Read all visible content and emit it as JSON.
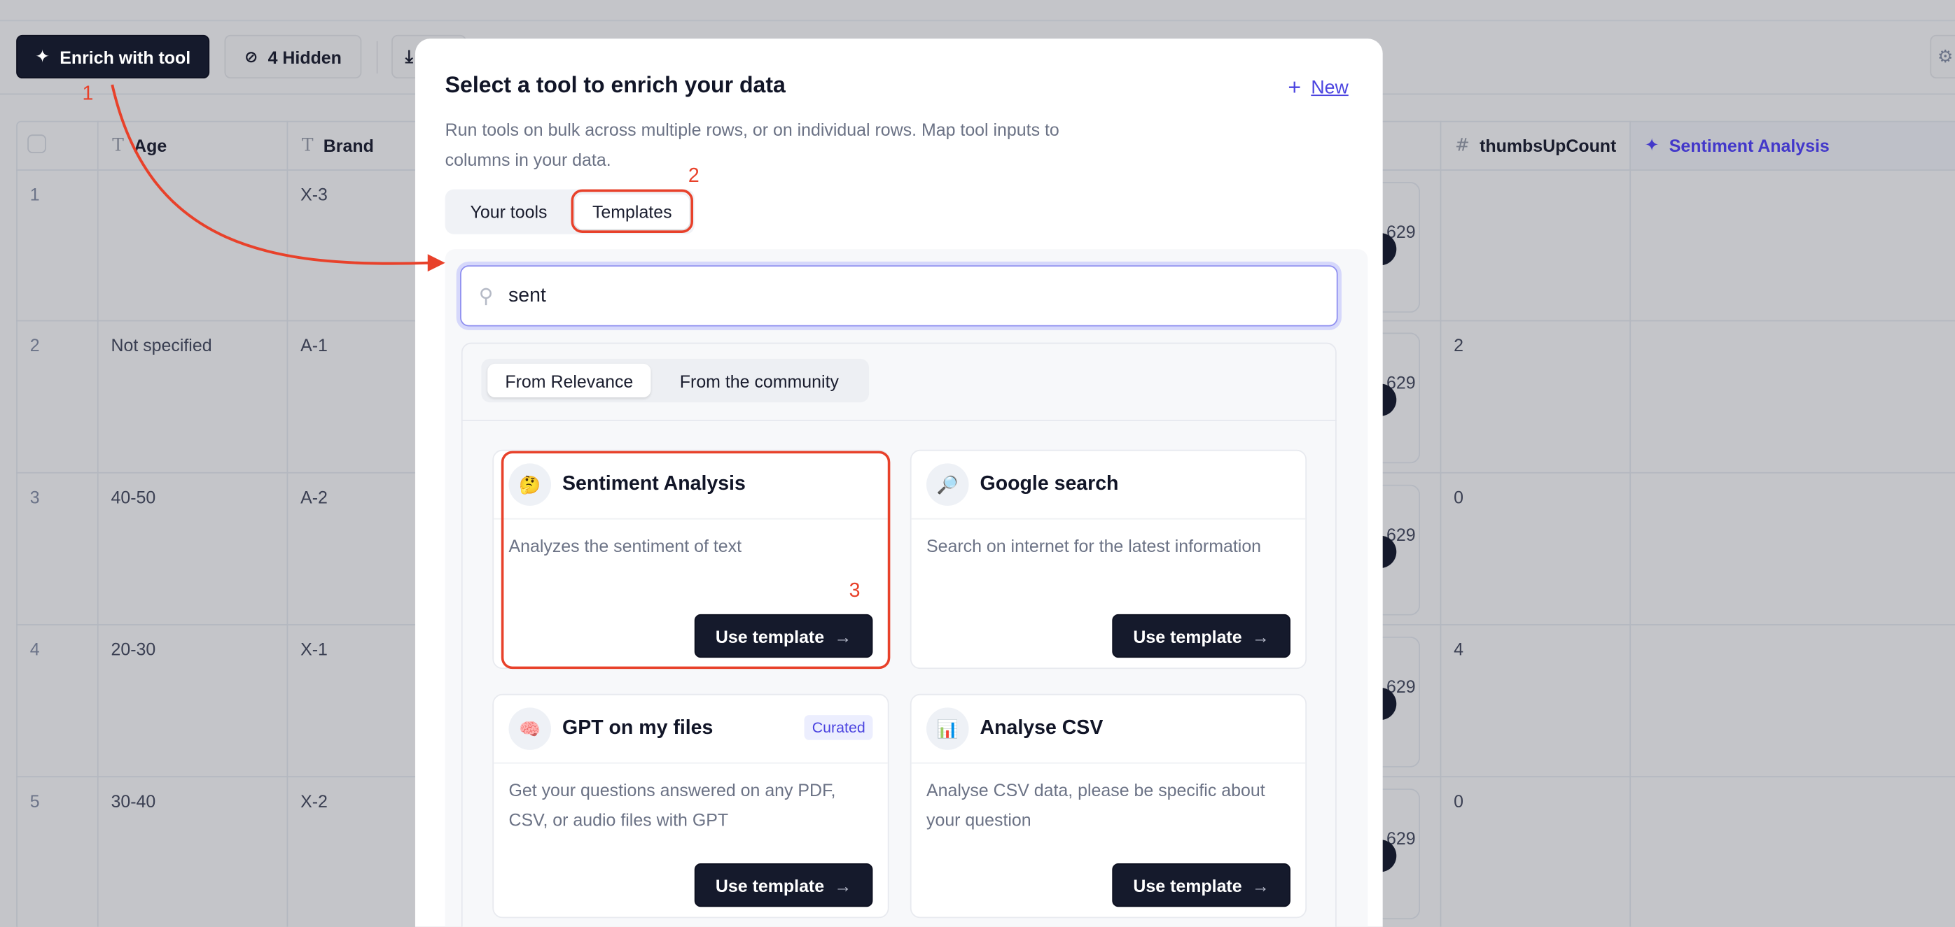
{
  "toolbar": {
    "enrich_label": "Enrich with tool",
    "hidden_label": "4 Hidden"
  },
  "table": {
    "columns": [
      {
        "label": "Age",
        "type_icon": "text-type-icon"
      },
      {
        "label": "Brand",
        "type_icon": "text-type-icon"
      },
      {
        "label": "thumbsUpCount",
        "type_icon": "number-type-icon"
      },
      {
        "label": "Sentiment Analysis",
        "type_icon": "sparkle-icon"
      }
    ],
    "rows": [
      {
        "num": "1",
        "age": "",
        "brand": "X-3",
        "partial": "629",
        "thumbs": ""
      },
      {
        "num": "2",
        "age": "Not specified",
        "brand": "A-1",
        "partial": "629",
        "thumbs": "2"
      },
      {
        "num": "3",
        "age": "40-50",
        "brand": "A-2",
        "partial": "629",
        "thumbs": "0"
      },
      {
        "num": "4",
        "age": "20-30",
        "brand": "X-1",
        "partial": "629",
        "thumbs": "4"
      },
      {
        "num": "5",
        "age": "30-40",
        "brand": "X-2",
        "partial": "629",
        "thumbs": "0"
      }
    ]
  },
  "modal": {
    "title": "Select a tool to enrich your data",
    "subtitle": "Run tools on bulk across multiple rows, or on individual rows. Map tool inputs to columns in your data.",
    "new_label": "New",
    "tabs": [
      "Your tools",
      "Templates"
    ],
    "active_tab": "Templates",
    "search_value": "sent",
    "source_tabs": [
      "From Relevance",
      "From the community"
    ],
    "active_source": "From Relevance",
    "cards": [
      {
        "name": "Sentiment Analysis",
        "icon": "🤔",
        "description": "Analyzes the sentiment of text",
        "button": "Use template",
        "badge": ""
      },
      {
        "name": "Google search",
        "icon": "🔎",
        "description": "Search on internet for the latest information",
        "button": "Use template",
        "badge": ""
      },
      {
        "name": "GPT on my files",
        "icon": "🧠",
        "description": "Get your questions answered on any PDF, CSV, or audio files with GPT",
        "button": "Use template",
        "badge": "Curated"
      },
      {
        "name": "Analyse CSV",
        "icon": "📊",
        "description": "Analyse CSV data, please be specific about your question",
        "button": "Use template",
        "badge": ""
      }
    ]
  },
  "annotations": [
    "1",
    "2",
    "3"
  ],
  "colors": {
    "annotation": "#e8412a",
    "accent": "#4b44e0",
    "dark_button": "#151a2c"
  }
}
